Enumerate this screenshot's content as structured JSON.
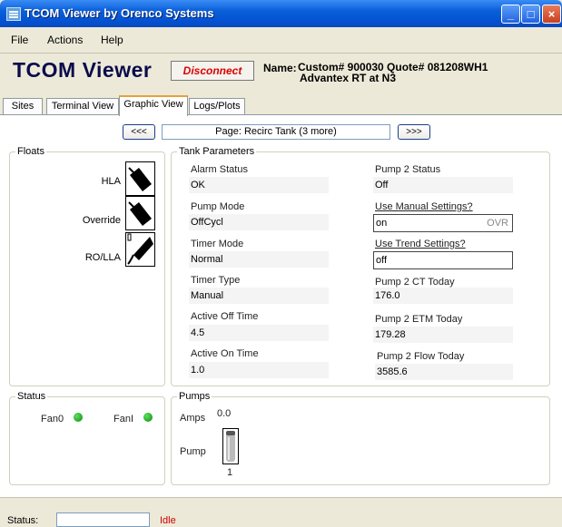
{
  "window": {
    "title": "TCOM Viewer by Orenco Systems"
  },
  "menu": [
    "File",
    "Actions",
    "Help"
  ],
  "header": {
    "logo": "TCOM Viewer",
    "disconnect_label": "Disconnect",
    "name_label": "Name:",
    "name_line1": "Custom# 900030   Quote# 081208WH1",
    "name_line2": "Advantex RT at N3"
  },
  "tabs": [
    "Sites",
    "Terminal View",
    "Graphic View",
    "Logs/Plots"
  ],
  "pager": {
    "prev": "<<<",
    "page_text": "Page: Recirc Tank (3 more)",
    "next": ">>>"
  },
  "floats": {
    "title": "Floats",
    "items": [
      {
        "label": "HLA"
      },
      {
        "label": "Override"
      },
      {
        "label": "RO/LLA"
      }
    ]
  },
  "tank": {
    "title": "Tank Parameters",
    "left": [
      {
        "label": "Alarm Status",
        "value": "OK"
      },
      {
        "label": "Pump Mode",
        "value": "OffCycl"
      },
      {
        "label": "Timer Mode",
        "value": "Normal"
      },
      {
        "label": "Timer Type",
        "value": "Manual"
      },
      {
        "label": "Active Off Time",
        "value": "4.5"
      },
      {
        "label": "Active On Time",
        "value": "1.0"
      }
    ],
    "right": [
      {
        "label": "Pump 2 Status",
        "value": "Off"
      },
      {
        "label": "Use Manual Settings?",
        "value": "on",
        "tag": "OVR"
      },
      {
        "label": "Use Trend Settings?",
        "value": "off"
      },
      {
        "label": "Pump 2 CT Today",
        "value": "176.0"
      },
      {
        "label": "Pump 2 ETM Today",
        "value": "179.28"
      },
      {
        "label": "Pump 2 Flow Today",
        "value": "3585.6"
      }
    ]
  },
  "status_group": {
    "title": "Status",
    "fan0": "Fan0",
    "fan1": "FanI"
  },
  "pumps": {
    "title": "Pumps",
    "amps_label": "Amps",
    "amps_value": "0.0",
    "pump_label": "Pump",
    "pump_number": "1"
  },
  "statusbar": {
    "label": "Status:",
    "state": "Idle"
  },
  "colors": {
    "titlebar": "#0a5fd9",
    "led_on": "#1a9a1a",
    "idle": "#cc0000",
    "disconnect": "#dd0000"
  }
}
